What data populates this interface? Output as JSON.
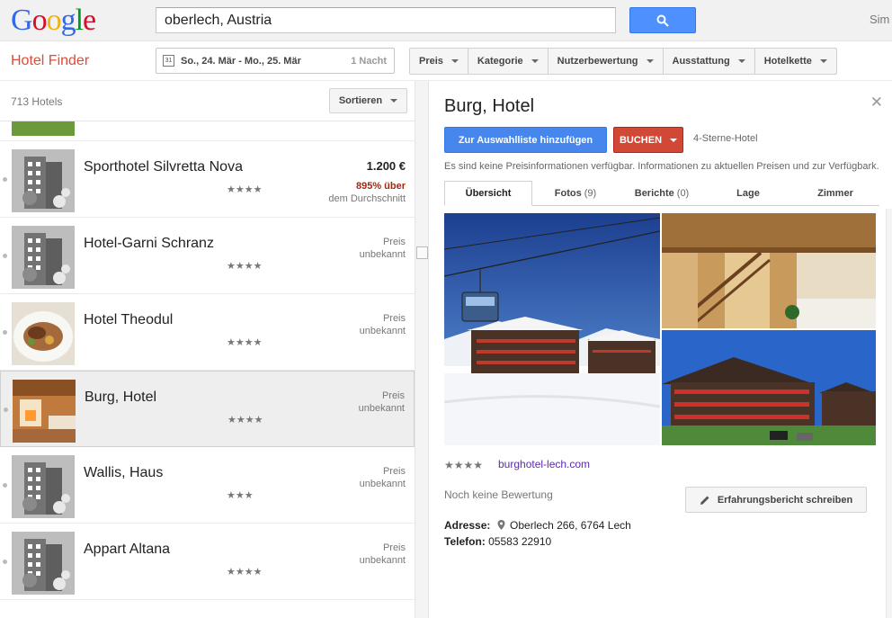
{
  "search": {
    "logo_letters": [
      {
        "ch": "G",
        "color": "#3369e8"
      },
      {
        "ch": "o",
        "color": "#d50f25"
      },
      {
        "ch": "o",
        "color": "#eeb211"
      },
      {
        "ch": "g",
        "color": "#3369e8"
      },
      {
        "ch": "l",
        "color": "#009925"
      },
      {
        "ch": "e",
        "color": "#d50f25"
      }
    ],
    "query": "oberlech, Austria",
    "user": "Sim"
  },
  "toolbar": {
    "title": "Hotel Finder",
    "calendar_day": "31",
    "dates": "So., 24. Mär - Mo., 25. Mär",
    "nights": "1 Nacht",
    "filters": [
      "Preis",
      "Kategorie",
      "Nutzerbewertung",
      "Ausstattung",
      "Hotelkette"
    ]
  },
  "list": {
    "count": "713 Hotels",
    "sort_label": "Sortieren",
    "partial_top_stars": "★★★★",
    "hotels": [
      {
        "name": "Sporthotel Silvretta Nova",
        "stars": "★★★★",
        "price": "1.200 €",
        "delta": "895% über",
        "avg": "dem Durchschnitt",
        "thumb": "placeholder"
      },
      {
        "name": "Hotel-Garni Schranz",
        "stars": "★★★★",
        "price_l1": "Preis",
        "price_l2": "unbekannt",
        "thumb": "placeholder"
      },
      {
        "name": "Hotel Theodul",
        "stars": "★★★★",
        "price_l1": "Preis",
        "price_l2": "unbekannt",
        "thumb": "food"
      },
      {
        "name": "Burg, Hotel",
        "stars": "★★★★",
        "price_l1": "Preis",
        "price_l2": "unbekannt",
        "thumb": "room",
        "selected": true
      },
      {
        "name": "Wallis, Haus",
        "stars": "★★★",
        "price_l1": "Preis",
        "price_l2": "unbekannt",
        "thumb": "placeholder"
      },
      {
        "name": "Appart Altana",
        "stars": "★★★★",
        "price_l1": "Preis",
        "price_l2": "unbekannt",
        "thumb": "placeholder"
      }
    ]
  },
  "detail": {
    "title": "Burg, Hotel",
    "add_button": "Zur Auswahlliste hinzufügen",
    "book_button": "BUCHEN",
    "category": "4-Sterne-Hotel",
    "price_info": "Es sind keine Preisinformationen verfügbar. Informationen zu aktuellen Preisen und zur Verfügbark...",
    "tabs": [
      {
        "label": "Übersicht",
        "num": ""
      },
      {
        "label": "Fotos",
        "num": "(9)"
      },
      {
        "label": "Berichte",
        "num": "(0)"
      },
      {
        "label": "Lage",
        "num": ""
      },
      {
        "label": "Zimmer",
        "num": ""
      }
    ],
    "stars": "★★★★",
    "website": "burghotel-lech.com",
    "review_status": "Noch keine Bewertung",
    "review_button": "Erfahrungsbericht schreiben",
    "address_label": "Adresse:",
    "address": "Oberlech 266, 6764 Lech",
    "phone_label": "Telefon:",
    "phone": "05583 22910"
  }
}
